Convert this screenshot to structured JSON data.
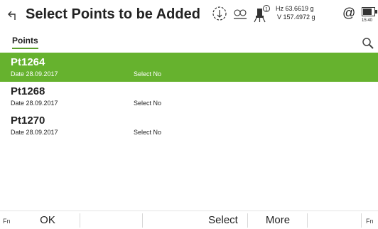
{
  "header": {
    "title": "Select Points to be Added",
    "back_icon": "back-arrow-icon",
    "hz_readout": "Hz 63.6619 g",
    "v_readout": "V  157.4972 g",
    "reflector_symbol": "@",
    "battery_time": "15:40"
  },
  "tabs": [
    {
      "label": "Points",
      "active": true
    }
  ],
  "points": [
    {
      "name": "Pt1264",
      "date": "Date  28.09.2017",
      "select": "Select  No",
      "selected": true
    },
    {
      "name": "Pt1268",
      "date": "Date  28.09.2017",
      "select": "Select  No",
      "selected": false
    },
    {
      "name": "Pt1270",
      "date": "Date  28.09.2017",
      "select": "Select  No",
      "selected": false
    }
  ],
  "softkeys": {
    "fn_left": "Fn",
    "ok": "OK",
    "select": "Select",
    "more": "More",
    "fn_right": "Fn"
  },
  "colors": {
    "accent": "#66b22e",
    "tab_underline": "#5aa02c"
  }
}
